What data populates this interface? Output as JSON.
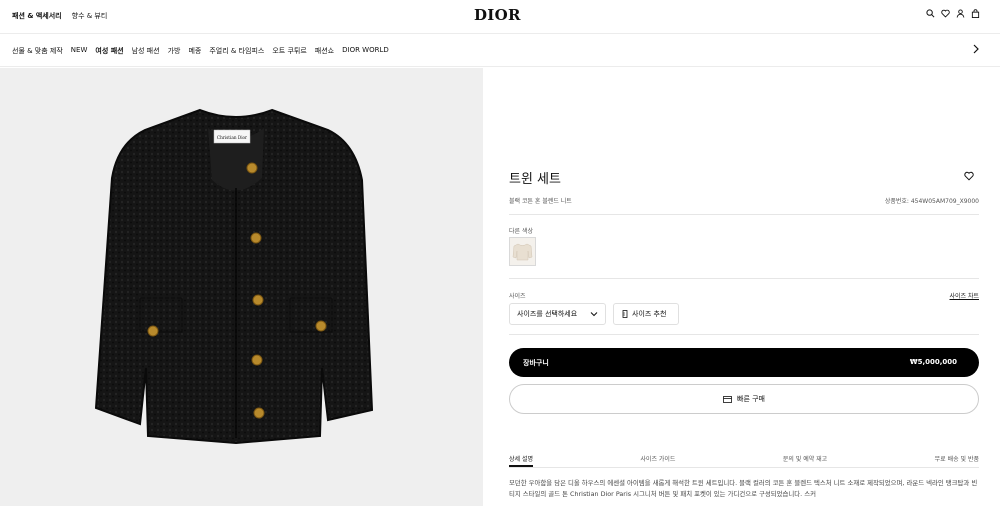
{
  "header": {
    "links": [
      "패션 & 액세서리",
      "향수 & 뷰티"
    ],
    "logo": "DIOR",
    "icons": [
      "search-icon",
      "heart-icon",
      "user-icon",
      "bag-icon"
    ]
  },
  "nav": {
    "items": [
      "선물 & 맞춤 제작",
      "NEW",
      "여성 패션",
      "남성 패션",
      "가방",
      "메종",
      "주얼리 & 타임피스",
      "오트 쿠튀르",
      "패션쇼",
      "DIOR WORLD"
    ],
    "active_item": "여성 패션"
  },
  "product": {
    "name": "트윈 세트",
    "subtitle": "블랙 코튼 혼 블렌드 니트",
    "reference": "상품번호: 454W05AM709_X9000",
    "color_label": "다른 색상",
    "size_label": "사이즈",
    "size_chart": "사이즈 차트",
    "size_placeholder": "사이즈를 선택하세요",
    "size_advice": "사이즈 추천",
    "cart_label": "장바구니",
    "price": "₩5,000,000",
    "quick_buy": "빠른 구매",
    "tabs": [
      "상세 설명",
      "사이즈 가이드",
      "문의 및 예약 재고",
      "무료 배송 및 반품"
    ],
    "description": "모던한 우아함을 담은 디올 하우스의 에센셜 아이템을 새롭게 해석한 트윈 세트입니다. 블랙 컬러의 코튼 혼 블렌드 텍스처 니트 소재로 제작되었으며, 라운드 넥라인 탱크탑과 빈티지 스타일의 골드 톤 Christian Dior Paris 시그니처 버튼 및 패치 포켓이 있는 가디건으로 구성되었습니다. 스커",
    "label_text": "Christian Dior"
  }
}
